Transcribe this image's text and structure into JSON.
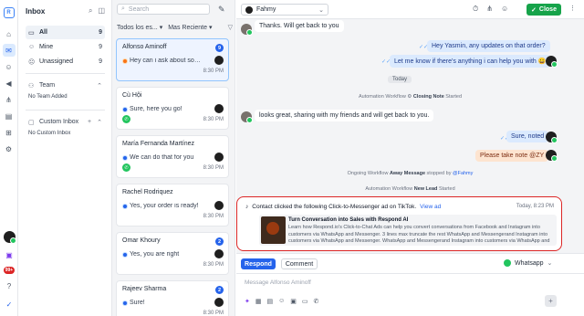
{
  "rail": {
    "logo": "R",
    "badge": "99+"
  },
  "inbox": {
    "title": "Inbox",
    "items": [
      {
        "label": "All",
        "count": "9"
      },
      {
        "label": "Mine",
        "count": "9"
      },
      {
        "label": "Unassigned",
        "count": "9"
      }
    ],
    "team_label": "Team",
    "team_sub": "No Team Added",
    "custom_label": "Custom Inbox",
    "custom_sub": "No Custom Inbox"
  },
  "convlist": {
    "search_placeholder": "Search",
    "filter_status": "Todos los es...",
    "filter_sort": "Mas Reciente",
    "cards": [
      {
        "name": "Alfonso Aminoff",
        "badge": "9",
        "preview": "Hey can i ask about some...",
        "time": "8:30 PM",
        "active": true
      },
      {
        "name": "Cù Hội",
        "badge": "",
        "preview": "Sure, here you go!",
        "time": "8:30 PM",
        "active": false
      },
      {
        "name": "María Fernanda Martínez",
        "badge": "",
        "preview": "We can do that for you",
        "time": "8:30 PM",
        "active": false
      },
      {
        "name": "Rachel Rodriquez",
        "badge": "",
        "preview": "Yes, your order is ready!",
        "time": "8:30 PM",
        "active": false
      },
      {
        "name": "Omar Khoury",
        "badge": "2",
        "preview": "Yes, you are right",
        "time": "8:30 PM",
        "active": false
      },
      {
        "name": "Rajeev Sharma",
        "badge": "2",
        "preview": "Sure!",
        "time": "8:30 PM",
        "active": false
      }
    ]
  },
  "chat": {
    "contact": "Fahmy",
    "close_label": "Close",
    "messages": {
      "in1": "Thanks. Will get back to you",
      "out1": "Hey Yasmin, any updates on that order?",
      "out2": "Let me know if there's anything i can help you with 😀",
      "day": "Today",
      "sys1_pre": "Automation Workflow",
      "sys1_bold": "Closing Note",
      "sys1_post": "Started",
      "in2": "looks great, sharing with my friends and will get back to you.",
      "out3": "Sure, noted",
      "note": "Please take note @ZY",
      "sys2_pre": "Ongoing Workflow",
      "sys2_bold": "Away Message",
      "sys2_mid": "stopped by",
      "sys2_mention": "@Fahmy",
      "sys3_pre": "Automation Workflow",
      "sys3_bold": "New Lead",
      "sys3_post": "Started"
    },
    "ad": {
      "header": "Contact clicked the following Click-to-Messenger ad on TikTok.",
      "link": "View ad",
      "date": "Today, 8:23 PM",
      "title": "Turn Conversation into Sales with Respond AI",
      "desc": "Learn how Respond.io's Click-to-Chat Ads can help you convert conversations from Facebook and Instagram into customers via WhatsApp and Messenger. 3 lines max truncate the rest WhatsApp and Messengerand Instagram into customers via WhatsApp and Messenger. WhatsApp and Messengerand Instagram into customers via WhatsApp and Messenger"
    },
    "composer": {
      "respond": "Respond",
      "comment": "Comment",
      "channel": "Whatsapp",
      "placeholder": "Message Alfonso Aminoff"
    }
  }
}
